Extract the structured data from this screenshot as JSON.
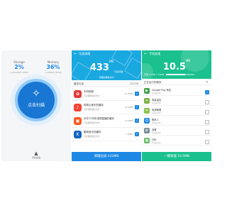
{
  "colors": {
    "primary_blue": "#1e88e5",
    "scan_blue": "#1976d2",
    "sky_blue": "#1aa8e0",
    "green": "#1ac08e"
  },
  "phone1": {
    "storage": {
      "label": "Storage",
      "value": "2%",
      "sub": "1.35GB/25.78GB"
    },
    "memory": {
      "label": "Memory",
      "value": "36%",
      "sub": "1.08GB/2.83GB"
    },
    "scan_button": {
      "label": "点击扫描",
      "icon": "broom-icon"
    },
    "footer": {
      "label": "手机加速",
      "icon": "rocket-icon"
    }
  },
  "phone2": {
    "title": "垃圾清理",
    "big_value": "433",
    "big_unit": "MB",
    "big_caption": "已选清理",
    "tip": "清理后释放空间",
    "section": {
      "label": "缓存垃圾",
      "size": "371MB"
    },
    "items": [
      {
        "name": "手机相册",
        "desc": "可清理的缓存文件",
        "size": "22.3MB",
        "color": "#e53935",
        "glyph": "✿",
        "checked": true
      },
      {
        "name": "网易云音乐的缓存",
        "desc": "可清理的缓存文件",
        "size": "18.2MB",
        "color": "#f44336",
        "glyph": "♪",
        "checked": true
      },
      {
        "name": "京东TV手机电视直播的缓存",
        "desc": "可清理的缓存文件",
        "size": "10.5MB",
        "color": "#ff5722",
        "glyph": "▣",
        "checked": true
      },
      {
        "name": "酷狗音乐的缓存",
        "desc": "可清理的缓存文件",
        "size": "7.8MB",
        "color": "#1565c0",
        "glyph": "K",
        "checked": true
      }
    ],
    "button_label": "清理垃圾 433MB"
  },
  "phone3": {
    "title": "手机加速",
    "big_value": "10.5",
    "big_unit": "MB",
    "memory_text": "已用 2.5GB / 3.8GB",
    "memory_fraction": 0.66,
    "section": {
      "label": "正在运行的程序"
    },
    "items": [
      {
        "name": "Google Play 商店",
        "desc": "后台运行中",
        "size": "",
        "color": "#43a047",
        "glyph": "▶",
        "checked": true
      },
      {
        "name": "电量监控",
        "desc": "后台运行中",
        "size": "",
        "color": "#7cb342",
        "glyph": "✦",
        "checked": false
      },
      {
        "name": "电源管理",
        "desc": "后台运行中",
        "size": "",
        "color": "#8bc34a",
        "glyph": "✦",
        "checked": false
      },
      {
        "name": "联系人",
        "desc": "后台运行中",
        "size": "",
        "color": "#1e88e5",
        "glyph": "☺",
        "checked": false
      },
      {
        "name": "设置",
        "desc": "后台运行中",
        "size": "",
        "color": "#78909c",
        "glyph": "⚙",
        "checked": false
      },
      {
        "name": "日历",
        "desc": "后台运行中",
        "size": "",
        "color": "#66bb6a",
        "glyph": "▦",
        "checked": false
      }
    ],
    "button_label": "一键清理 10.5MB"
  }
}
